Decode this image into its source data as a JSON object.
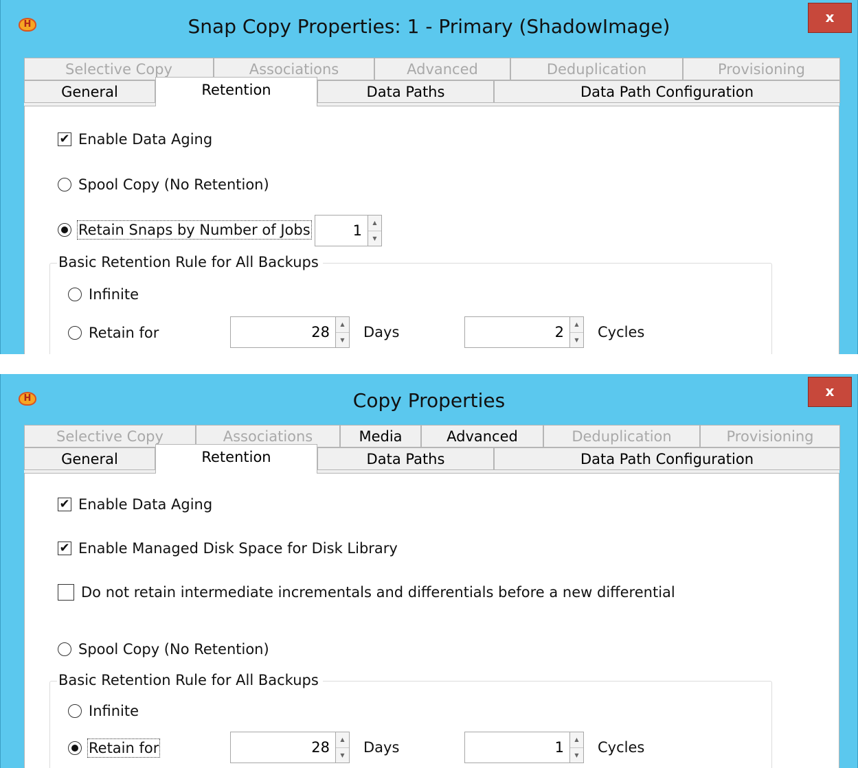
{
  "windows": [
    {
      "title": "Snap Copy Properties: 1 - Primary (ShadowImage)",
      "close_label": "x",
      "app_icon_letter": "H",
      "tabs_top": [
        {
          "label": "Selective Copy",
          "enabled": false
        },
        {
          "label": "Associations",
          "enabled": false
        },
        {
          "label": "Advanced",
          "enabled": false
        },
        {
          "label": "Deduplication",
          "enabled": false
        },
        {
          "label": "Provisioning",
          "enabled": false
        }
      ],
      "tabs_bottom": [
        {
          "label": "General"
        },
        {
          "label": "Retention",
          "selected": true
        },
        {
          "label": "Data Paths"
        },
        {
          "label": "Data Path Configuration"
        }
      ],
      "enable_data_aging": {
        "label": "Enable Data Aging",
        "checked": true
      },
      "spool_copy": {
        "label": "Spool Copy (No Retention)",
        "selected": false
      },
      "retain_snaps": {
        "label": "Retain Snaps by Number of Jobs",
        "selected": true,
        "value": "1"
      },
      "group": {
        "title": "Basic Retention Rule for All Backups",
        "infinite": {
          "label": "Infinite",
          "selected": false
        },
        "retain_for": {
          "label": "Retain for",
          "selected": false
        },
        "days": {
          "value": "28",
          "unit": "Days"
        },
        "cycles": {
          "value": "2",
          "unit": "Cycles"
        }
      }
    },
    {
      "title": "Copy Properties",
      "close_label": "x",
      "app_icon_letter": "H",
      "tabs_top": [
        {
          "label": "Selective Copy",
          "enabled": false
        },
        {
          "label": "Associations",
          "enabled": false
        },
        {
          "label": "Media",
          "enabled": true
        },
        {
          "label": "Advanced",
          "enabled": true
        },
        {
          "label": "Deduplication",
          "enabled": false
        },
        {
          "label": "Provisioning",
          "enabled": false
        }
      ],
      "tabs_bottom": [
        {
          "label": "General"
        },
        {
          "label": "Retention",
          "selected": true
        },
        {
          "label": "Data Paths"
        },
        {
          "label": "Data Path Configuration"
        }
      ],
      "enable_data_aging": {
        "label": "Enable Data Aging",
        "checked": true
      },
      "managed_disk": {
        "label": "Enable Managed Disk Space for Disk Library",
        "checked": true
      },
      "no_retain_incrementals": {
        "label": "Do not retain intermediate incrementals and differentials before a new differential",
        "checked": false
      },
      "spool_copy": {
        "label": "Spool Copy (No Retention)",
        "selected": false
      },
      "group": {
        "title": "Basic Retention Rule for All Backups",
        "infinite": {
          "label": "Infinite",
          "selected": false
        },
        "retain_for": {
          "label": "Retain for",
          "selected": true
        },
        "days": {
          "value": "28",
          "unit": "Days"
        },
        "cycles": {
          "value": "1",
          "unit": "Cycles"
        }
      }
    }
  ],
  "icons": {
    "app": "app-logo-icon",
    "close": "close-icon",
    "check": "✔",
    "spin_up": "▲",
    "spin_down": "▼"
  }
}
